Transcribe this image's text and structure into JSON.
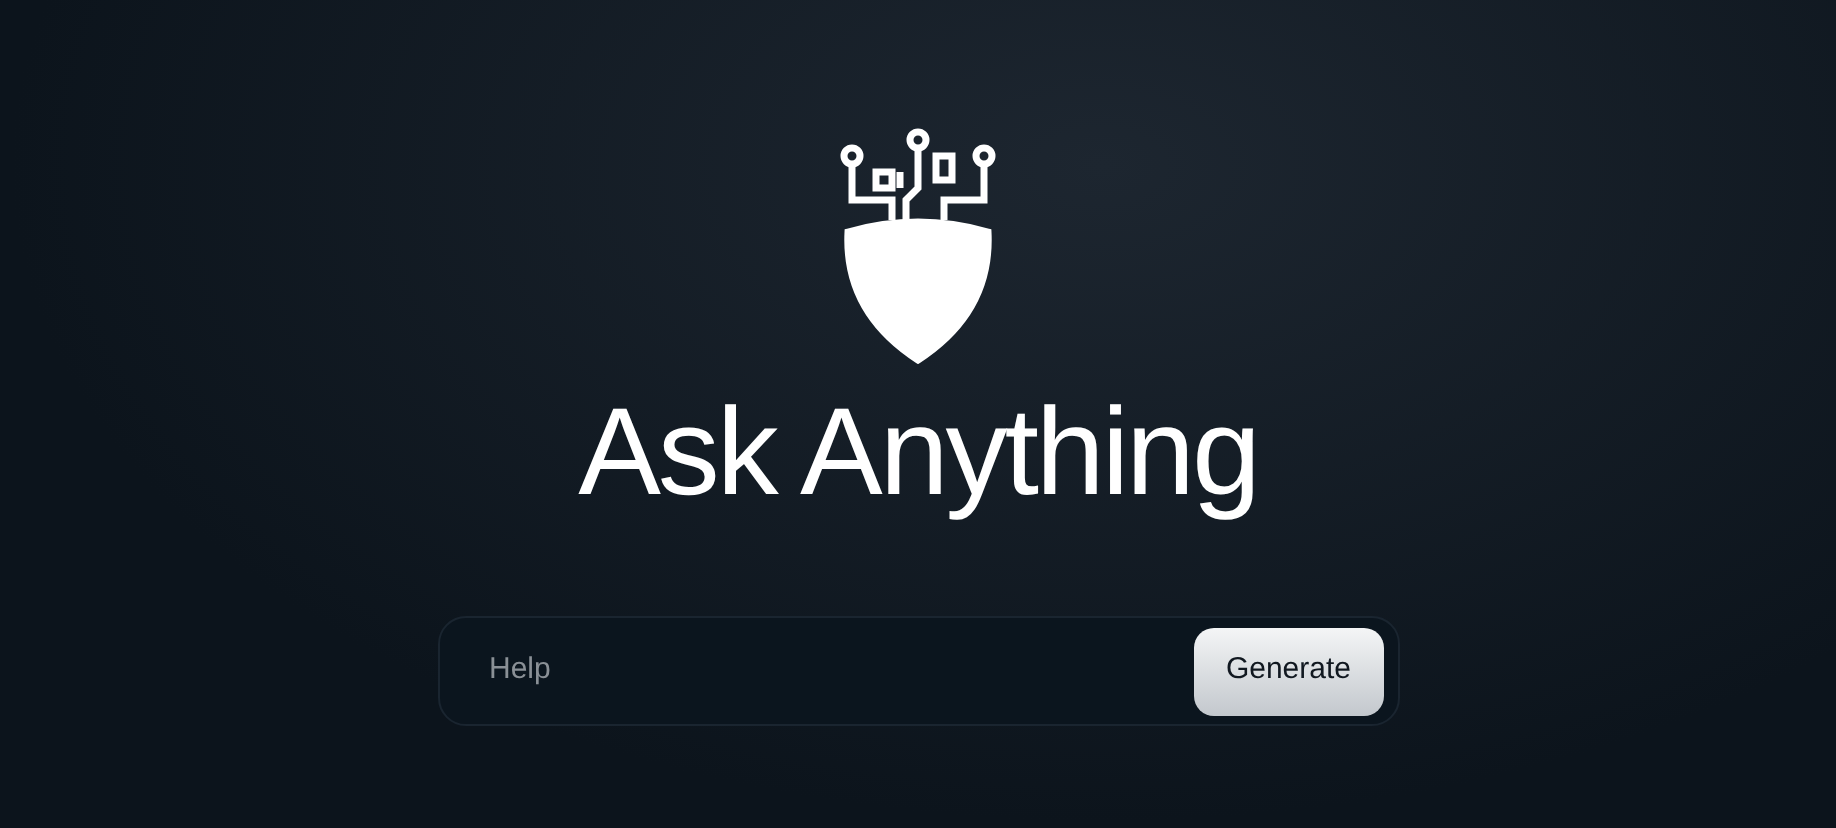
{
  "title": "Ask Anything",
  "search": {
    "placeholder": "Help"
  },
  "buttons": [
    "Generate"
  ]
}
